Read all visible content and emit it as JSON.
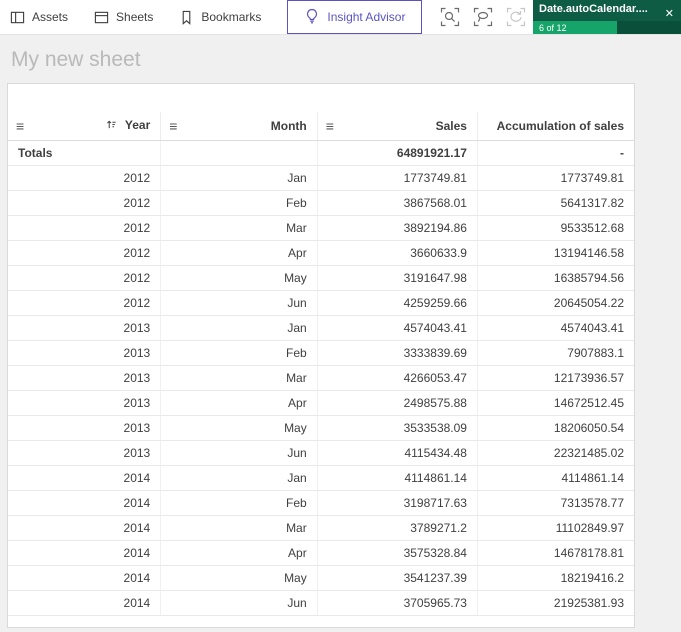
{
  "toolbar": {
    "assets_label": "Assets",
    "sheets_label": "Sheets",
    "bookmarks_label": "Bookmarks",
    "insight_advisor_label": "Insight Advisor",
    "selection": {
      "title": "Date.autoCalendar....",
      "count": "6 of 12"
    }
  },
  "sheet": {
    "title": "My new sheet"
  },
  "table": {
    "columns": [
      "Year",
      "Month",
      "Sales",
      "Accumulation of sales"
    ],
    "totals": {
      "label": "Totals",
      "month": "",
      "sales": "64891921.17",
      "accumulation": "-"
    },
    "rows": [
      [
        "2012",
        "Jan",
        "1773749.81",
        "1773749.81"
      ],
      [
        "2012",
        "Feb",
        "3867568.01",
        "5641317.82"
      ],
      [
        "2012",
        "Mar",
        "3892194.86",
        "9533512.68"
      ],
      [
        "2012",
        "Apr",
        "3660633.9",
        "13194146.58"
      ],
      [
        "2012",
        "May",
        "3191647.98",
        "16385794.56"
      ],
      [
        "2012",
        "Jun",
        "4259259.66",
        "20645054.22"
      ],
      [
        "2013",
        "Jan",
        "4574043.41",
        "4574043.41"
      ],
      [
        "2013",
        "Feb",
        "3333839.69",
        "7907883.1"
      ],
      [
        "2013",
        "Mar",
        "4266053.47",
        "12173936.57"
      ],
      [
        "2013",
        "Apr",
        "2498575.88",
        "14672512.45"
      ],
      [
        "2013",
        "May",
        "3533538.09",
        "18206050.54"
      ],
      [
        "2013",
        "Jun",
        "4115434.48",
        "22321485.02"
      ],
      [
        "2014",
        "Jan",
        "4114861.14",
        "4114861.14"
      ],
      [
        "2014",
        "Feb",
        "3198717.63",
        "7313578.77"
      ],
      [
        "2014",
        "Mar",
        "3789271.2",
        "11102849.97"
      ],
      [
        "2014",
        "Apr",
        "3575328.84",
        "14678178.81"
      ],
      [
        "2014",
        "May",
        "3541237.39",
        "18219416.2"
      ],
      [
        "2014",
        "Jun",
        "3705965.73",
        "21925381.93"
      ]
    ]
  },
  "icons": {
    "assets": "panel",
    "sheets": "window",
    "bookmarks": "bookmark-ribbon",
    "insight_advisor": "lightbulb",
    "smart_search": "magnifier-in-brackets",
    "lasso_selection": "lasso-in-brackets",
    "step_back": "circular-arrow-in-brackets",
    "clear_selections": "slashed-circle-in-brackets",
    "column_menu": "≡",
    "sort_ascending": "↑",
    "close": "✕"
  },
  "colors": {
    "insight_accent": "#5b54c0",
    "selection_dark_green": "#0e5c43",
    "selection_bright_green": "#17a46a",
    "title_gray": "#b9b9b9",
    "text": "#404040"
  }
}
